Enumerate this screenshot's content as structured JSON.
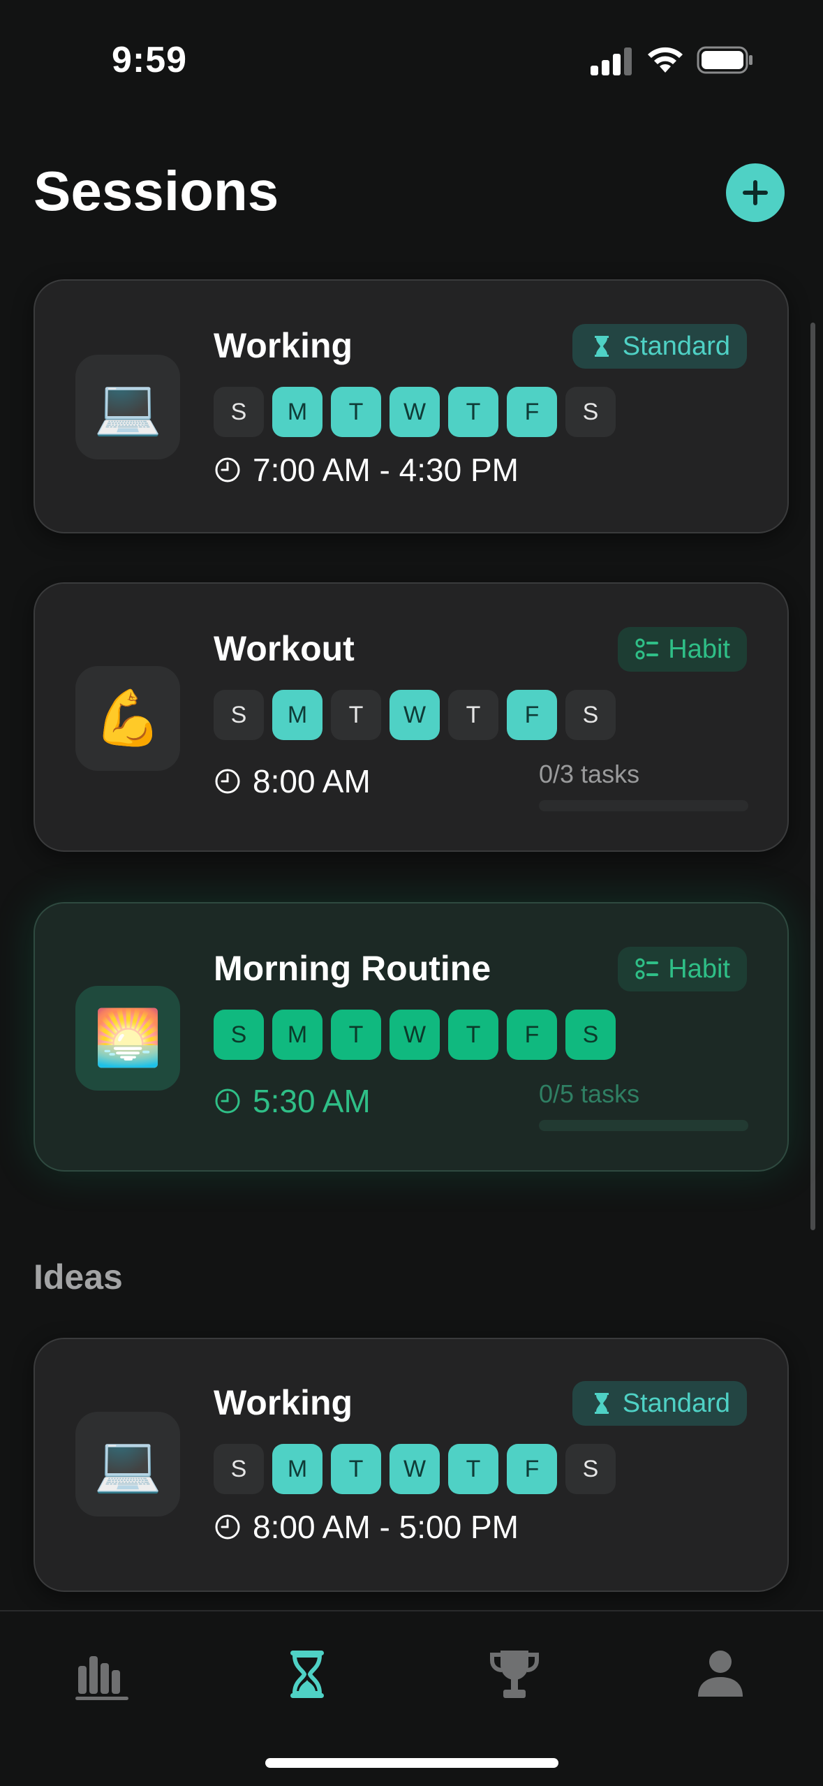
{
  "status_bar": {
    "time": "9:59"
  },
  "header": {
    "title": "Sessions"
  },
  "sessions": [
    {
      "title": "Working",
      "emoji": "💻",
      "type": "Standard",
      "days": [
        {
          "label": "S",
          "active": false
        },
        {
          "label": "M",
          "active": true
        },
        {
          "label": "T",
          "active": true
        },
        {
          "label": "W",
          "active": true
        },
        {
          "label": "T",
          "active": true
        },
        {
          "label": "F",
          "active": true
        },
        {
          "label": "S",
          "active": false
        }
      ],
      "time": "7:00 AM - 4:30 PM"
    },
    {
      "title": "Workout",
      "emoji": "💪",
      "type": "Habit",
      "days": [
        {
          "label": "S",
          "active": false
        },
        {
          "label": "M",
          "active": true
        },
        {
          "label": "T",
          "active": false
        },
        {
          "label": "W",
          "active": true
        },
        {
          "label": "T",
          "active": false
        },
        {
          "label": "F",
          "active": true
        },
        {
          "label": "S",
          "active": false
        }
      ],
      "time": "8:00 AM",
      "tasks": "0/3 tasks",
      "progress": 0
    },
    {
      "title": "Morning Routine",
      "emoji": "🌅",
      "type": "Habit",
      "days": [
        {
          "label": "S",
          "active": true
        },
        {
          "label": "M",
          "active": true
        },
        {
          "label": "T",
          "active": true
        },
        {
          "label": "W",
          "active": true
        },
        {
          "label": "T",
          "active": true
        },
        {
          "label": "F",
          "active": true
        },
        {
          "label": "S",
          "active": true
        }
      ],
      "time": "5:30 AM",
      "tasks": "0/5 tasks",
      "progress": 0
    }
  ],
  "ideas": {
    "section_title": "Ideas",
    "items": [
      {
        "title": "Working",
        "emoji": "💻",
        "type": "Standard",
        "days": [
          {
            "label": "S",
            "active": false
          },
          {
            "label": "M",
            "active": true
          },
          {
            "label": "T",
            "active": true
          },
          {
            "label": "W",
            "active": true
          },
          {
            "label": "T",
            "active": true
          },
          {
            "label": "F",
            "active": true
          },
          {
            "label": "S",
            "active": false
          }
        ],
        "time": "8:00 AM - 5:00 PM"
      }
    ]
  },
  "tabs": [
    {
      "name": "stats",
      "icon": "bar-chart-icon",
      "active": false
    },
    {
      "name": "sessions",
      "icon": "hourglass-icon",
      "active": true
    },
    {
      "name": "achievements",
      "icon": "trophy-icon",
      "active": false
    },
    {
      "name": "profile",
      "icon": "person-icon",
      "active": false
    }
  ],
  "colors": {
    "accent": "#4fd1c5",
    "habit": "#10b97f",
    "background": "#121313",
    "card": "#232324"
  }
}
